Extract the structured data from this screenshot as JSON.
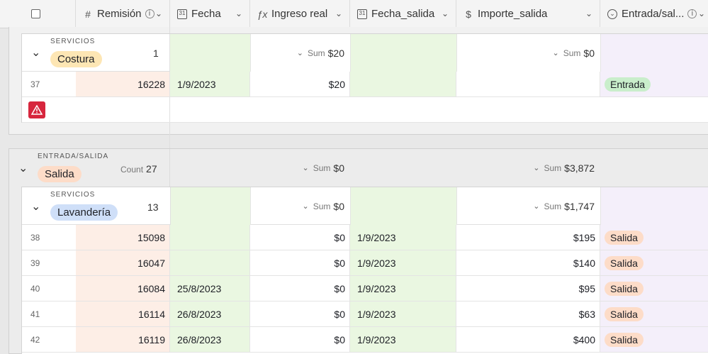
{
  "columns": [
    {
      "label": "Remisión",
      "icon": "hash-icon",
      "glyph": "#",
      "info": true
    },
    {
      "label": "Fecha",
      "icon": "calendar-icon",
      "glyph": "31",
      "info": false
    },
    {
      "label": "Ingreso real",
      "icon": "formula-icon",
      "glyph": "ƒx",
      "info": false
    },
    {
      "label": "Fecha_salida",
      "icon": "calendar-icon",
      "glyph": "31",
      "info": false
    },
    {
      "label": "Importe_salida",
      "icon": "dollar-icon",
      "glyph": "$",
      "info": false
    },
    {
      "label": "Entrada/sal...",
      "icon": "single-select-icon",
      "glyph": "⌄",
      "info": true
    }
  ],
  "group1": {
    "field_label": "SERVICIOS",
    "value": "Costura",
    "count": "1",
    "sum_label": "Sum",
    "sum_ingreso": "$20",
    "sum_importe": "$0",
    "chip_color": "#fde6b4"
  },
  "row37": {
    "num": "37",
    "remision": "16228",
    "fecha": "1/9/2023",
    "ingreso": "$20",
    "fecha_salida": "",
    "importe": "",
    "estado": "Entrada"
  },
  "group2": {
    "field_label": "ENTRADA/SALIDA",
    "value": "Salida",
    "count_label": "Count",
    "count": "27",
    "sum_label": "Sum",
    "sum_ingreso": "$0",
    "sum_importe": "$3,872",
    "chip_color": "#fddcc8"
  },
  "group3": {
    "field_label": "SERVICIOS",
    "value": "Lavandería",
    "count": "13",
    "sum_label": "Sum",
    "sum_ingreso": "$0",
    "sum_importe": "$1,747",
    "chip_color": "#cfdff8"
  },
  "rows": [
    {
      "num": "38",
      "remision": "15098",
      "fecha": "",
      "ingreso": "$0",
      "fecha_salida": "1/9/2023",
      "importe": "$195",
      "estado": "Salida"
    },
    {
      "num": "39",
      "remision": "16047",
      "fecha": "",
      "ingreso": "$0",
      "fecha_salida": "1/9/2023",
      "importe": "$140",
      "estado": "Salida"
    },
    {
      "num": "40",
      "remision": "16084",
      "fecha": "25/8/2023",
      "ingreso": "$0",
      "fecha_salida": "1/9/2023",
      "importe": "$95",
      "estado": "Salida"
    },
    {
      "num": "41",
      "remision": "16114",
      "fecha": "26/8/2023",
      "ingreso": "$0",
      "fecha_salida": "1/9/2023",
      "importe": "$63",
      "estado": "Salida"
    },
    {
      "num": "42",
      "remision": "16119",
      "fecha": "26/8/2023",
      "ingreso": "$0",
      "fecha_salida": "1/9/2023",
      "importe": "$400",
      "estado": "Salida"
    }
  ],
  "colors": {
    "remision_bg": "#fdeee6",
    "date_bg": "#eaf7e1",
    "select_bg": "#f4effa",
    "entrada_tag": "#c9eecb",
    "salida_tag": "#fddcc8",
    "warning": "#d7263d"
  }
}
